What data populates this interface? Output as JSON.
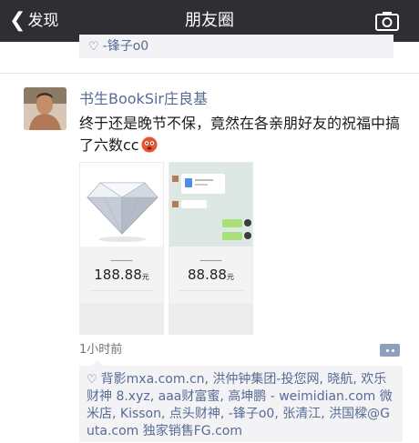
{
  "nav": {
    "back_label": "发现",
    "title": "朋友圈"
  },
  "previous_post": {
    "likes_tail": "-锋子o0"
  },
  "post": {
    "username": "书生BookSir庄良基",
    "text": "终于还是晚节不保，竟然在各亲朋好友的祝福中搞了六数cc",
    "images": [
      {
        "amount": "188.88",
        "unit": "元"
      },
      {
        "amount": "88.88",
        "unit": "元"
      }
    ],
    "time": "1小时前",
    "likes": "背影mxa.com.cn, 洪仲钟集团-投您网, 晓航, 欢乐财神 8.xyz, aaa财富蜜, 高坤鹏 - weimidian.com 微米店, Kisson, 点头财神, -锋子o0, 张清江, 洪国樑@Guta.com 独家销售FG.com"
  },
  "colors": {
    "navbar_bg": "#2e2e33",
    "link_blue": "#576b95",
    "like_box_bg": "#f3f3f5"
  },
  "icons": [
    "chevron-left-icon",
    "camera-icon",
    "heart-icon",
    "comment-icon",
    "diamond-image",
    "emoji-icon"
  ]
}
